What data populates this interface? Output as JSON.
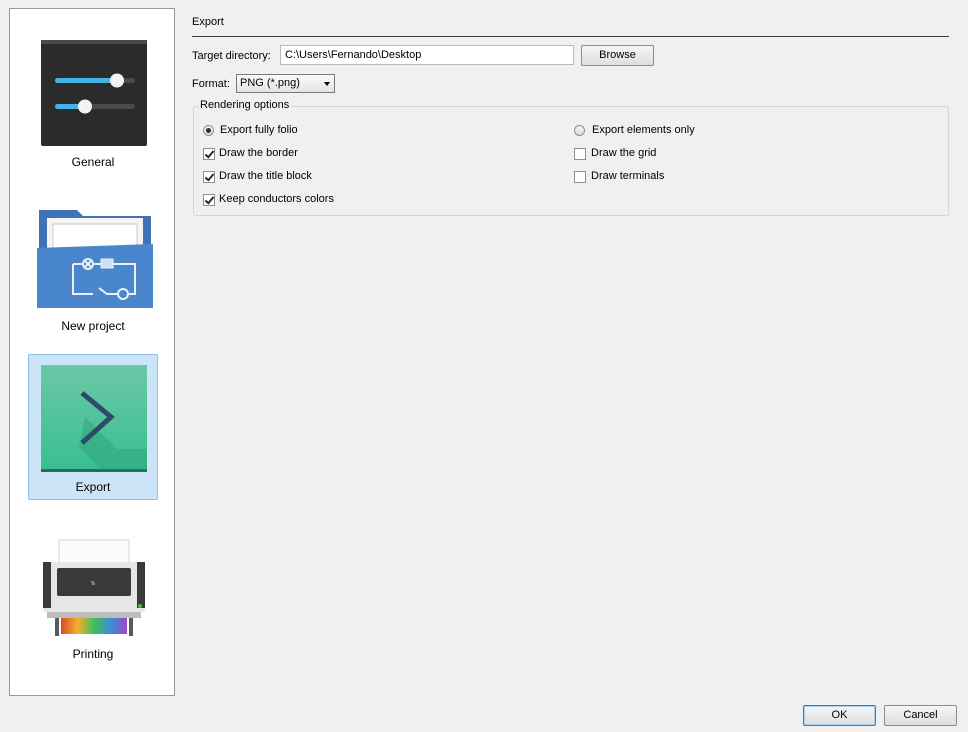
{
  "sidebar": {
    "items": [
      {
        "label": "General",
        "icon": "sliders-icon"
      },
      {
        "label": "New project",
        "icon": "folder-circuit-icon"
      },
      {
        "label": "Export",
        "icon": "export-arrow-icon",
        "selected": true
      },
      {
        "label": "Printing",
        "icon": "printer-icon"
      }
    ]
  },
  "export": {
    "section_title": "Export",
    "target_directory_label": "Target directory:",
    "target_directory_value": "C:\\Users\\Fernando\\Desktop",
    "browse_label": "Browse",
    "format_label": "Format:",
    "format_value": "PNG (*.png)",
    "rendering": {
      "title": "Rendering options",
      "export_fully_folio": "Export fully folio",
      "export_elements_only": "Export elements only",
      "draw_border": "Draw the border",
      "draw_title_block": "Draw the title block",
      "keep_conductors_colors": "Keep conductors colors",
      "draw_grid": "Draw the grid",
      "draw_terminals": "Draw terminals"
    }
  },
  "state": {
    "export_mode": "fully_folio",
    "draw_border": true,
    "draw_title_block": true,
    "keep_conductors_colors": true,
    "draw_grid": false,
    "draw_terminals": false
  },
  "footer": {
    "ok_label": "OK",
    "cancel_label": "Cancel"
  },
  "colors": {
    "selection_bg": "#cce4f7",
    "export_icon_teal": "#3ec193"
  }
}
